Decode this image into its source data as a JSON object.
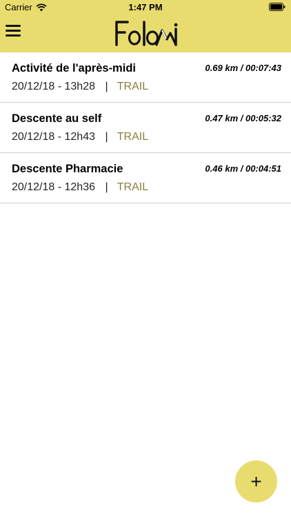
{
  "status_bar": {
    "carrier": "Carrier",
    "time": "1:47 PM",
    "wifi_icon": "wifi-icon",
    "battery_icon": "battery-icon"
  },
  "header": {
    "menu_icon": "hamburger-menu-icon",
    "logo_text": "FoloMi",
    "background_color": "#e9dc6e"
  },
  "activities": [
    {
      "title": "Activité de l'après-midi",
      "stats": "0.69 km / 00:07:43",
      "date": "20/12/18 - 13h28",
      "separator": "|",
      "type": "TRAIL"
    },
    {
      "title": "Descente au self",
      "stats": "0.47 km / 00:05:32",
      "date": "20/12/18 - 12h43",
      "separator": "|",
      "type": "TRAIL"
    },
    {
      "title": "Descente Pharmacie",
      "stats": "0.46 km / 00:04:51",
      "date": "20/12/18 - 12h36",
      "separator": "|",
      "type": "TRAIL"
    }
  ],
  "fab": {
    "label": "+",
    "icon": "plus-icon"
  },
  "colors": {
    "accent": "#e9dc6e",
    "type_text": "#8a7d3a",
    "divider": "#cfcfcf"
  }
}
